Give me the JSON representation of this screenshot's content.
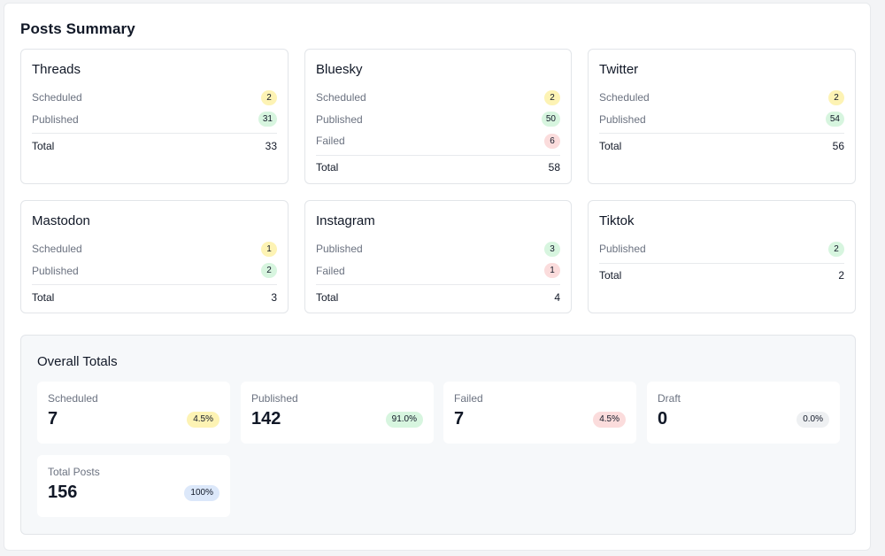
{
  "page_title": "Posts Summary",
  "platforms": [
    {
      "name": "Threads",
      "stats": [
        {
          "label": "Scheduled",
          "count": "2",
          "color": "yellow"
        },
        {
          "label": "Published",
          "count": "31",
          "color": "green"
        }
      ],
      "total_label": "Total",
      "total": "33"
    },
    {
      "name": "Bluesky",
      "stats": [
        {
          "label": "Scheduled",
          "count": "2",
          "color": "yellow"
        },
        {
          "label": "Published",
          "count": "50",
          "color": "green"
        },
        {
          "label": "Failed",
          "count": "6",
          "color": "red"
        }
      ],
      "total_label": "Total",
      "total": "58"
    },
    {
      "name": "Twitter",
      "stats": [
        {
          "label": "Scheduled",
          "count": "2",
          "color": "yellow"
        },
        {
          "label": "Published",
          "count": "54",
          "color": "green"
        }
      ],
      "total_label": "Total",
      "total": "56"
    },
    {
      "name": "Mastodon",
      "stats": [
        {
          "label": "Scheduled",
          "count": "1",
          "color": "yellow"
        },
        {
          "label": "Published",
          "count": "2",
          "color": "green"
        }
      ],
      "total_label": "Total",
      "total": "3"
    },
    {
      "name": "Instagram",
      "stats": [
        {
          "label": "Published",
          "count": "3",
          "color": "green"
        },
        {
          "label": "Failed",
          "count": "1",
          "color": "red"
        }
      ],
      "total_label": "Total",
      "total": "4"
    },
    {
      "name": "Tiktok",
      "stats": [
        {
          "label": "Published",
          "count": "2",
          "color": "green"
        }
      ],
      "total_label": "Total",
      "total": "2"
    }
  ],
  "overall": {
    "title": "Overall Totals",
    "tiles": [
      {
        "label": "Scheduled",
        "value": "7",
        "percent": "4.5%",
        "color": "yellow"
      },
      {
        "label": "Published",
        "value": "142",
        "percent": "91.0%",
        "color": "green"
      },
      {
        "label": "Failed",
        "value": "7",
        "percent": "4.5%",
        "color": "red"
      },
      {
        "label": "Draft",
        "value": "0",
        "percent": "0.0%",
        "color": "gray"
      },
      {
        "label": "Total Posts",
        "value": "156",
        "percent": "100%",
        "color": "blue"
      }
    ]
  },
  "colors": {
    "yellow": "#fdf3b4",
    "green": "#d7f5df",
    "red": "#fbdcdc",
    "gray": "#eef0f2",
    "blue": "#dce8fa"
  }
}
